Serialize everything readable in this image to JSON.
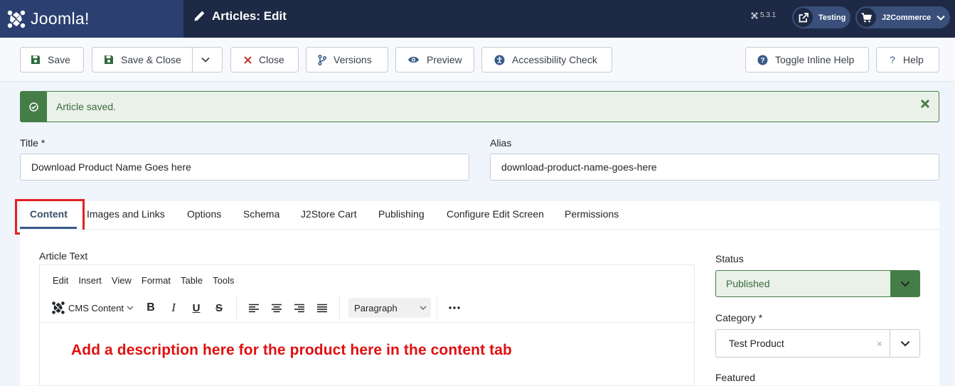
{
  "header": {
    "logo_text": "Joomla!",
    "page_title": "Articles: Edit",
    "version": "5.3.1",
    "site_button": "Testing",
    "user_menu": "J2Commerce"
  },
  "toolbar": {
    "save": "Save",
    "save_close": "Save & Close",
    "close": "Close",
    "versions": "Versions",
    "preview": "Preview",
    "accessibility": "Accessibility Check",
    "toggle_help": "Toggle Inline Help",
    "help": "Help"
  },
  "alert": {
    "message": "Article saved.",
    "color": "#457d46"
  },
  "form": {
    "title_label": "Title *",
    "title_value": "Download Product Name Goes here",
    "alias_label": "Alias",
    "alias_value": "download-product-name-goes-here"
  },
  "tabs": [
    {
      "label": "Content",
      "active": true
    },
    {
      "label": "Images and Links"
    },
    {
      "label": "Options"
    },
    {
      "label": "Schema"
    },
    {
      "label": "J2Store Cart"
    },
    {
      "label": "Publishing"
    },
    {
      "label": "Configure Edit Screen"
    },
    {
      "label": "Permissions"
    }
  ],
  "editor": {
    "label": "Article Text",
    "menu": [
      "Edit",
      "Insert",
      "View",
      "Format",
      "Table",
      "Tools"
    ],
    "cms_content": "CMS Content",
    "block_format": "Paragraph",
    "annotation": "Add a description here for the product here in the content tab"
  },
  "sidebar": {
    "status_label": "Status",
    "status_value": "Published",
    "category_label": "Category *",
    "category_value": "Test Product",
    "featured_label": "Featured"
  },
  "colors": {
    "header_bg": "#1e2a45",
    "logo_bg": "#2b4070",
    "success": "#457d46",
    "highlight": "#e02020"
  }
}
